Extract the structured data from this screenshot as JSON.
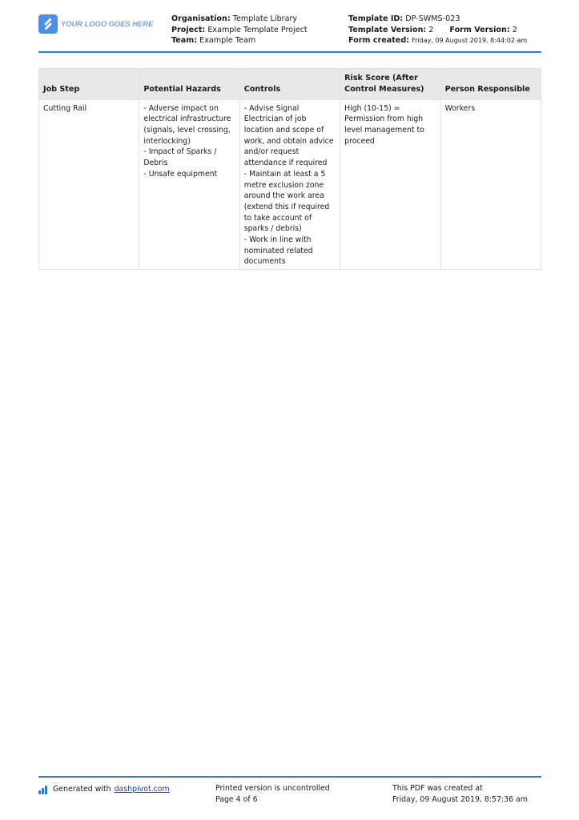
{
  "header": {
    "logo_text": "YOUR LOGO GOES HERE",
    "organisation_label": "Organisation:",
    "organisation_value": " Template Library",
    "project_label": "Project:",
    "project_value": "Example Template Project",
    "team_label": "Team:",
    "team_value": "Example Team",
    "template_id_label": "Template ID:",
    "template_id_value": "DP-SWMS-023",
    "template_version_label": "Template Version:",
    "template_version_value": "2",
    "form_version_label": "Form Version:",
    "form_version_value": "2",
    "form_created_label": "Form created:",
    "form_created_value": "Friday, 09 August 2019, 8:44:02 am"
  },
  "table": {
    "columns": [
      "Job Step",
      "Potential Hazards",
      "Controls",
      "Risk Score (After Control Measures)",
      "Person Responsible"
    ],
    "rows": [
      {
        "job_step": "Cutting Rail",
        "hazards": "- Adverse impact on electrical infrastructure (signals, level crossing, interlocking)\n- Impact of Sparks / Debris\n- Unsafe equipment",
        "controls": "- Advise Signal Electrician of job location and scope of work, and obtain advice and/or request attendance if required\n- Maintain at least a 5 metre exclusion zone around the work area (extend this if required to take account of sparks / debris)\n- Work in line with nominated related documents",
        "risk_score": "High (10-15) = Permission from high level management to proceed",
        "person_responsible": "Workers"
      }
    ]
  },
  "footer": {
    "generated_text": "Generated with",
    "generated_link": "dashpivot.com",
    "uncontrolled_text": "Printed version is uncontrolled",
    "page_text": "Page 4 of 6",
    "pdf_created_label": "This PDF was created at",
    "pdf_created_value": "Friday, 09 August 2019, 8:57:36 am"
  },
  "colors": {
    "accent": "#2f7bd2",
    "logo": "#4a8fe6",
    "table_header_bg": "#e8e8e8",
    "table_border": "#e2e2e2",
    "link": "#1a3fb3"
  }
}
